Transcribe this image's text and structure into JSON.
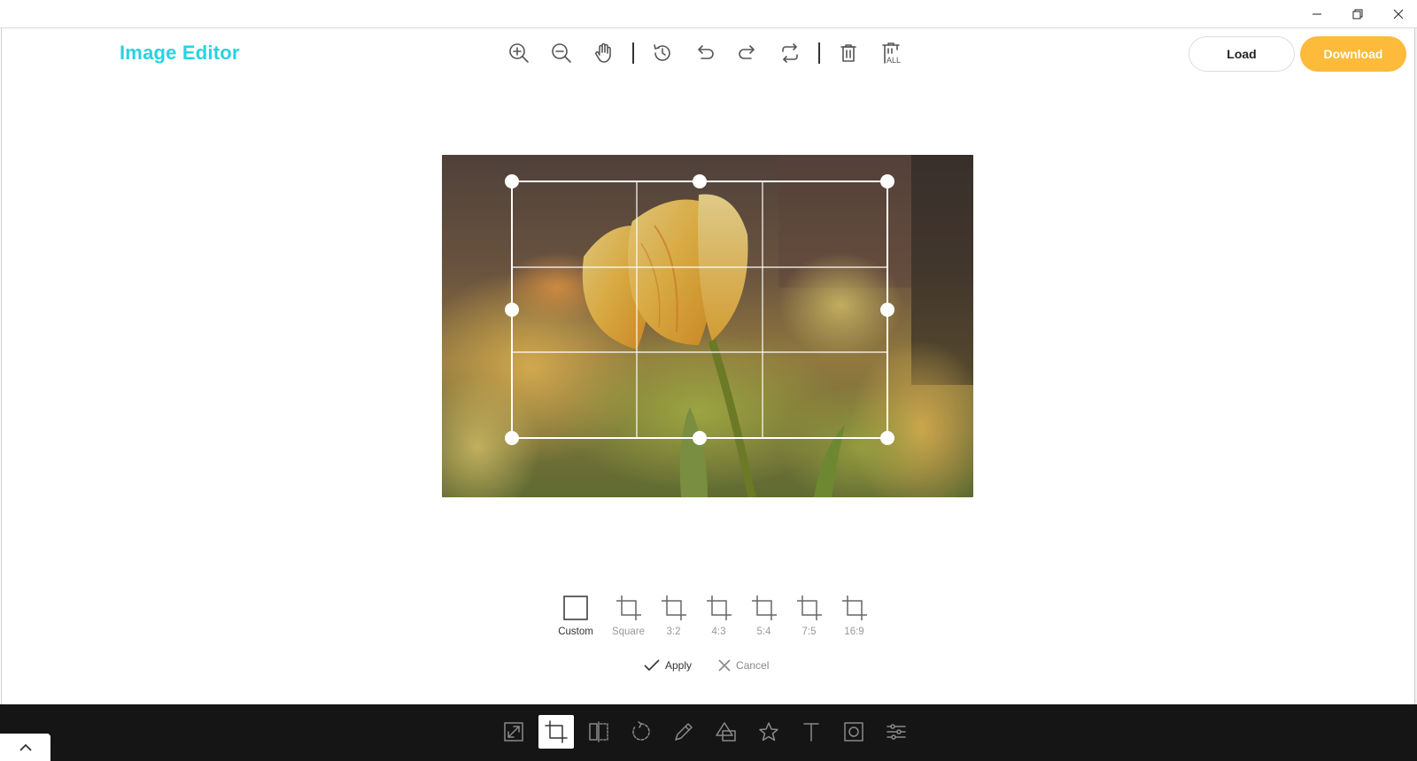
{
  "window": {
    "controls": [
      "minimize",
      "restore",
      "close"
    ]
  },
  "header": {
    "logo": "Image Editor",
    "load_label": "Load",
    "download_label": "Download",
    "accent": "#27d3e0",
    "download_color": "#fdba3b"
  },
  "toolbar": {
    "icons": [
      "zoom-in-icon",
      "zoom-out-icon",
      "hand-icon",
      "history-icon",
      "undo-icon",
      "redo-icon",
      "reset-icon",
      "delete-icon",
      "delete-all-icon"
    ],
    "delete_all_text": "ALL"
  },
  "crop": {
    "presets": [
      {
        "label": "Custom",
        "selected": true
      },
      {
        "label": "Square"
      },
      {
        "label": "3:2"
      },
      {
        "label": "4:3"
      },
      {
        "label": "5:4"
      },
      {
        "label": "7:5"
      },
      {
        "label": "16:9"
      }
    ],
    "apply_label": "Apply",
    "cancel_label": "Cancel"
  },
  "menu": {
    "items": [
      "resize",
      "crop",
      "flip",
      "rotate",
      "draw",
      "shape",
      "icon",
      "text",
      "mask",
      "filter"
    ],
    "active": "crop"
  }
}
